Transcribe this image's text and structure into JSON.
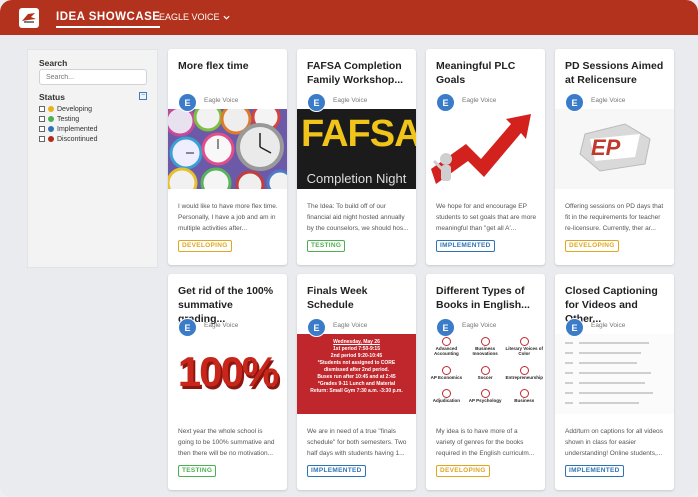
{
  "header": {
    "title": "IDEA SHOWCASE",
    "nav_label": "EAGLE VOICE"
  },
  "sidebar": {
    "search_title": "Search",
    "search_placeholder": "Search...",
    "status_title": "Status",
    "collapse_symbol": "−",
    "statuses": [
      {
        "label": "Developing",
        "color": "#e8b019"
      },
      {
        "label": "Testing",
        "color": "#4caf50"
      },
      {
        "label": "Implemented",
        "color": "#2e74b5"
      },
      {
        "label": "Discontinued",
        "color": "#b02a1c"
      }
    ]
  },
  "cards": [
    {
      "title": "More flex time",
      "author": "Eagle Voice",
      "avatar": "E",
      "image": "clocks-icon",
      "desc": "I would like to have more flex time. Personally, I have a job and am in multiple activities after...",
      "status": "DEVELOPING"
    },
    {
      "title": "FAFSA Completion Family Workshop...",
      "author": "Eagle Voice",
      "avatar": "E",
      "image": "fafsa-sign",
      "image_text": "FAFSA",
      "image_subtext": "Completion Night",
      "desc": "The Idea: To build off of our financial aid night hosted annually by the counselors, we should hos...",
      "status": "TESTING"
    },
    {
      "title": "Meaningful PLC Goals",
      "author": "Eagle Voice",
      "avatar": "E",
      "image": "arrow-figure",
      "desc": "We hope for and encourage EP students to set goals that are more meaningful than \"get all A'...",
      "status": "IMPLEMENTED"
    },
    {
      "title": "PD Sessions Aimed at Relicensure",
      "author": "Eagle Voice",
      "avatar": "E",
      "image": "ep-logo",
      "image_text": "EP",
      "desc": "Offering sessions on PD days that fit in the requirements for teacher re-licensure. Currently, ther ar...",
      "status": "DEVELOPING"
    },
    {
      "title": "Get rid of the 100% summative grading...",
      "author": "Eagle Voice",
      "avatar": "E",
      "image": "hundred-percent",
      "image_text": "100%",
      "desc": "Next year the whole school is going to be 100% summative and then there will be no motivation...",
      "status": "TESTING"
    },
    {
      "title": "Finals Week Schedule",
      "author": "Eagle Voice",
      "avatar": "E",
      "image": "schedule-poster",
      "image_lines": [
        "Wednesday, May 26",
        "1st period 7:50-9:15",
        "2nd period 9:20-10:45",
        "*Students not assigned to CORE",
        "dismissed after 2nd period.",
        "Buses run after 10:45 and at 2:45",
        "*Grades 9-11 Lunch and Material",
        "Return: Small Gym 7:30 a.m. -3:30 p.m."
      ],
      "desc": "We are in need of a true \"finals schedule\" for both semesters. Two half days with students having 1...",
      "status": "IMPLEMENTED"
    },
    {
      "title": "Different Types of Books in English...",
      "author": "Eagle Voice",
      "avatar": "E",
      "image": "genre-grid",
      "image_labels": [
        "Advanced Accounting",
        "Business Innovations",
        "Literary Voices of Color",
        "AP Economics",
        "Soccer",
        "Entrepreneurship",
        "Adjudication",
        "AP Psychology",
        "Business"
      ],
      "desc": "My idea is to have more of a variety of genres for the books required in the English curriculm...",
      "status": "DEVELOPING"
    },
    {
      "title": "Closed Captioning for Videos and Other...",
      "author": "Eagle Voice",
      "avatar": "E",
      "image": "caption-screenshot",
      "desc": "Add/turn on captions for all videos shown in class for easier understanding! Online students,...",
      "status": "IMPLEMENTED"
    }
  ]
}
